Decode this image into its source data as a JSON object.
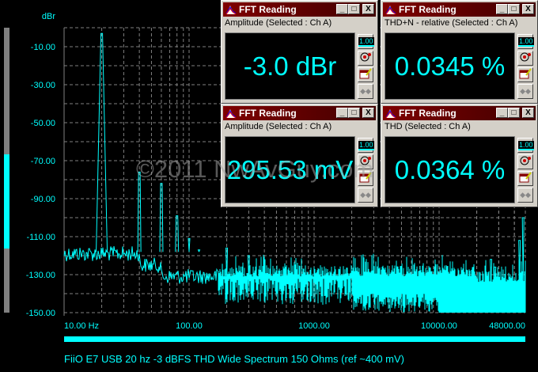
{
  "chart_data": {
    "type": "line",
    "title": "FiiO E7 USB 20 hz -3 dBFS THD Wide Spectrum 150 Ohms (ref ~400 mV)",
    "ylabel": "dBr",
    "xscale": "log",
    "xlim": [
      10,
      48000
    ],
    "ylim": [
      -150,
      0
    ],
    "grid": true,
    "y_ticks": [
      "-10.00",
      "-30.00",
      "-50.00",
      "-70.00",
      "-90.00",
      "-110.00",
      "-130.00",
      "-150.00"
    ],
    "y_tick_values": [
      -10,
      -30,
      -50,
      -70,
      -90,
      -110,
      -130,
      -150
    ],
    "x_ticks": [
      "10.00 Hz",
      "100.00",
      "1000.00",
      "10000.00",
      "48000.00"
    ],
    "x_tick_values": [
      10,
      100,
      1000,
      10000,
      48000
    ],
    "peaks": [
      {
        "freq": 20,
        "db": -3
      },
      {
        "freq": 40,
        "db": -76
      },
      {
        "freq": 60,
        "db": -82
      },
      {
        "freq": 80,
        "db": -99
      },
      {
        "freq": 100,
        "db": -111
      },
      {
        "freq": 120,
        "db": -117
      },
      {
        "freq": 200,
        "db": -116
      },
      {
        "freq": 300,
        "db": -120
      },
      {
        "freq": 26000,
        "db": -122
      },
      {
        "freq": 28000,
        "db": -126
      },
      {
        "freq": 44000,
        "db": -112
      },
      {
        "freq": 47000,
        "db": -100
      }
    ],
    "noise_floor_db": {
      "low_freq": -115,
      "mid_freq": -131,
      "high_freq": -131
    },
    "series_color": "#00ffff"
  },
  "windows": [
    {
      "title": "FFT Reading",
      "label": "Amplitude (Selected : Ch A)",
      "value": "-3.0 dBr"
    },
    {
      "title": "FFT Reading",
      "label": "THD+N - relative (Selected : Ch A)",
      "value": "0.0345 %"
    },
    {
      "title": "FFT Reading",
      "label": "Amplitude (Selected : Ch A)",
      "value": "295.53 mV"
    },
    {
      "title": "FFT Reading",
      "label": "THD (Selected : Ch A)",
      "value": "0.0364 %"
    }
  ],
  "window_buttons": {
    "minimize": "_",
    "maximize": "□",
    "close": "X",
    "scale": "1.00"
  },
  "watermark": "©2011 NwAvGuy.com"
}
